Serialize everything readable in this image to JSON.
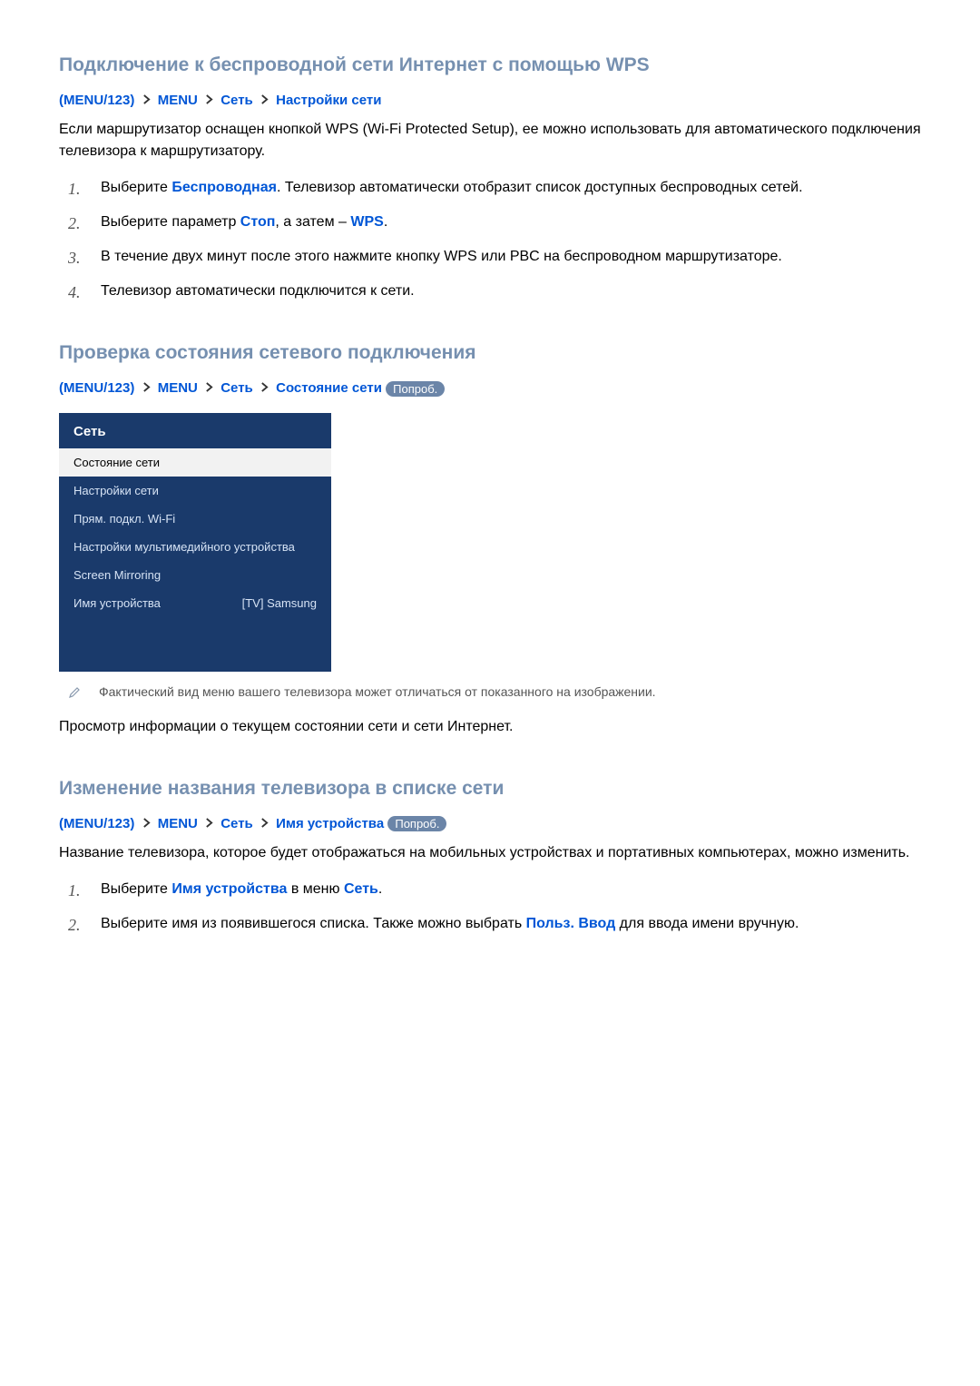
{
  "section1": {
    "title": "Подключение к беспроводной сети Интернет с помощью WPS",
    "breadcrumb": {
      "part1": "MENU/123",
      "part2": "MENU",
      "part3": "Сеть",
      "part4": "Настройки сети"
    },
    "intro": "Если маршрутизатор оснащен кнопкой WPS (Wi-Fi Protected Setup), ее можно использовать для автоматического подключения телевизора к маршрутизатору.",
    "steps": {
      "s1_prefix": "Выберите ",
      "s1_bold": "Беспроводная",
      "s1_suffix": ". Телевизор автоматически отобразит список доступных беспроводных сетей.",
      "s2_prefix": "Выберите параметр ",
      "s2_bold1": "Стоп",
      "s2_mid": ", а затем – ",
      "s2_bold2": "WPS",
      "s2_suffix": ".",
      "s3": "В течение двух минут после этого нажмите кнопку WPS или PBC на беспроводном маршрутизаторе.",
      "s4": "Телевизор автоматически подключится к сети."
    }
  },
  "section2": {
    "title": "Проверка состояния сетевого подключения",
    "breadcrumb": {
      "part1": "MENU/123",
      "part2": "MENU",
      "part3": "Сеть",
      "part4": "Состояние сети",
      "pill": "Попроб."
    },
    "menu": {
      "header": "Сеть",
      "row1": "Состояние сети",
      "row2": "Настройки сети",
      "row3": "Прям. подкл. Wi-Fi",
      "row4": "Настройки мультимедийного устройства",
      "row5": "Screen Mirroring",
      "row6_label": "Имя устройства",
      "row6_value": "[TV] Samsung"
    },
    "note": "Фактический вид меню вашего телевизора может отличаться от показанного на изображении.",
    "body": "Просмотр информации о текущем состоянии сети и сети Интернет."
  },
  "section3": {
    "title": "Изменение названия телевизора в списке сети",
    "breadcrumb": {
      "part1": "MENU/123",
      "part2": "MENU",
      "part3": "Сеть",
      "part4": "Имя устройства",
      "pill": "Попроб."
    },
    "intro": "Название телевизора, которое будет отображаться на мобильных устройствах и портативных компьютерах, можно изменить.",
    "steps": {
      "s1_prefix": "Выберите ",
      "s1_bold1": "Имя устройства",
      "s1_mid": " в меню ",
      "s1_bold2": "Сеть",
      "s1_suffix": ".",
      "s2_prefix": "Выберите имя из появившегося списка. Также можно выбрать ",
      "s2_bold": "Польз. Ввод",
      "s2_suffix": " для ввода имени вручную."
    }
  }
}
